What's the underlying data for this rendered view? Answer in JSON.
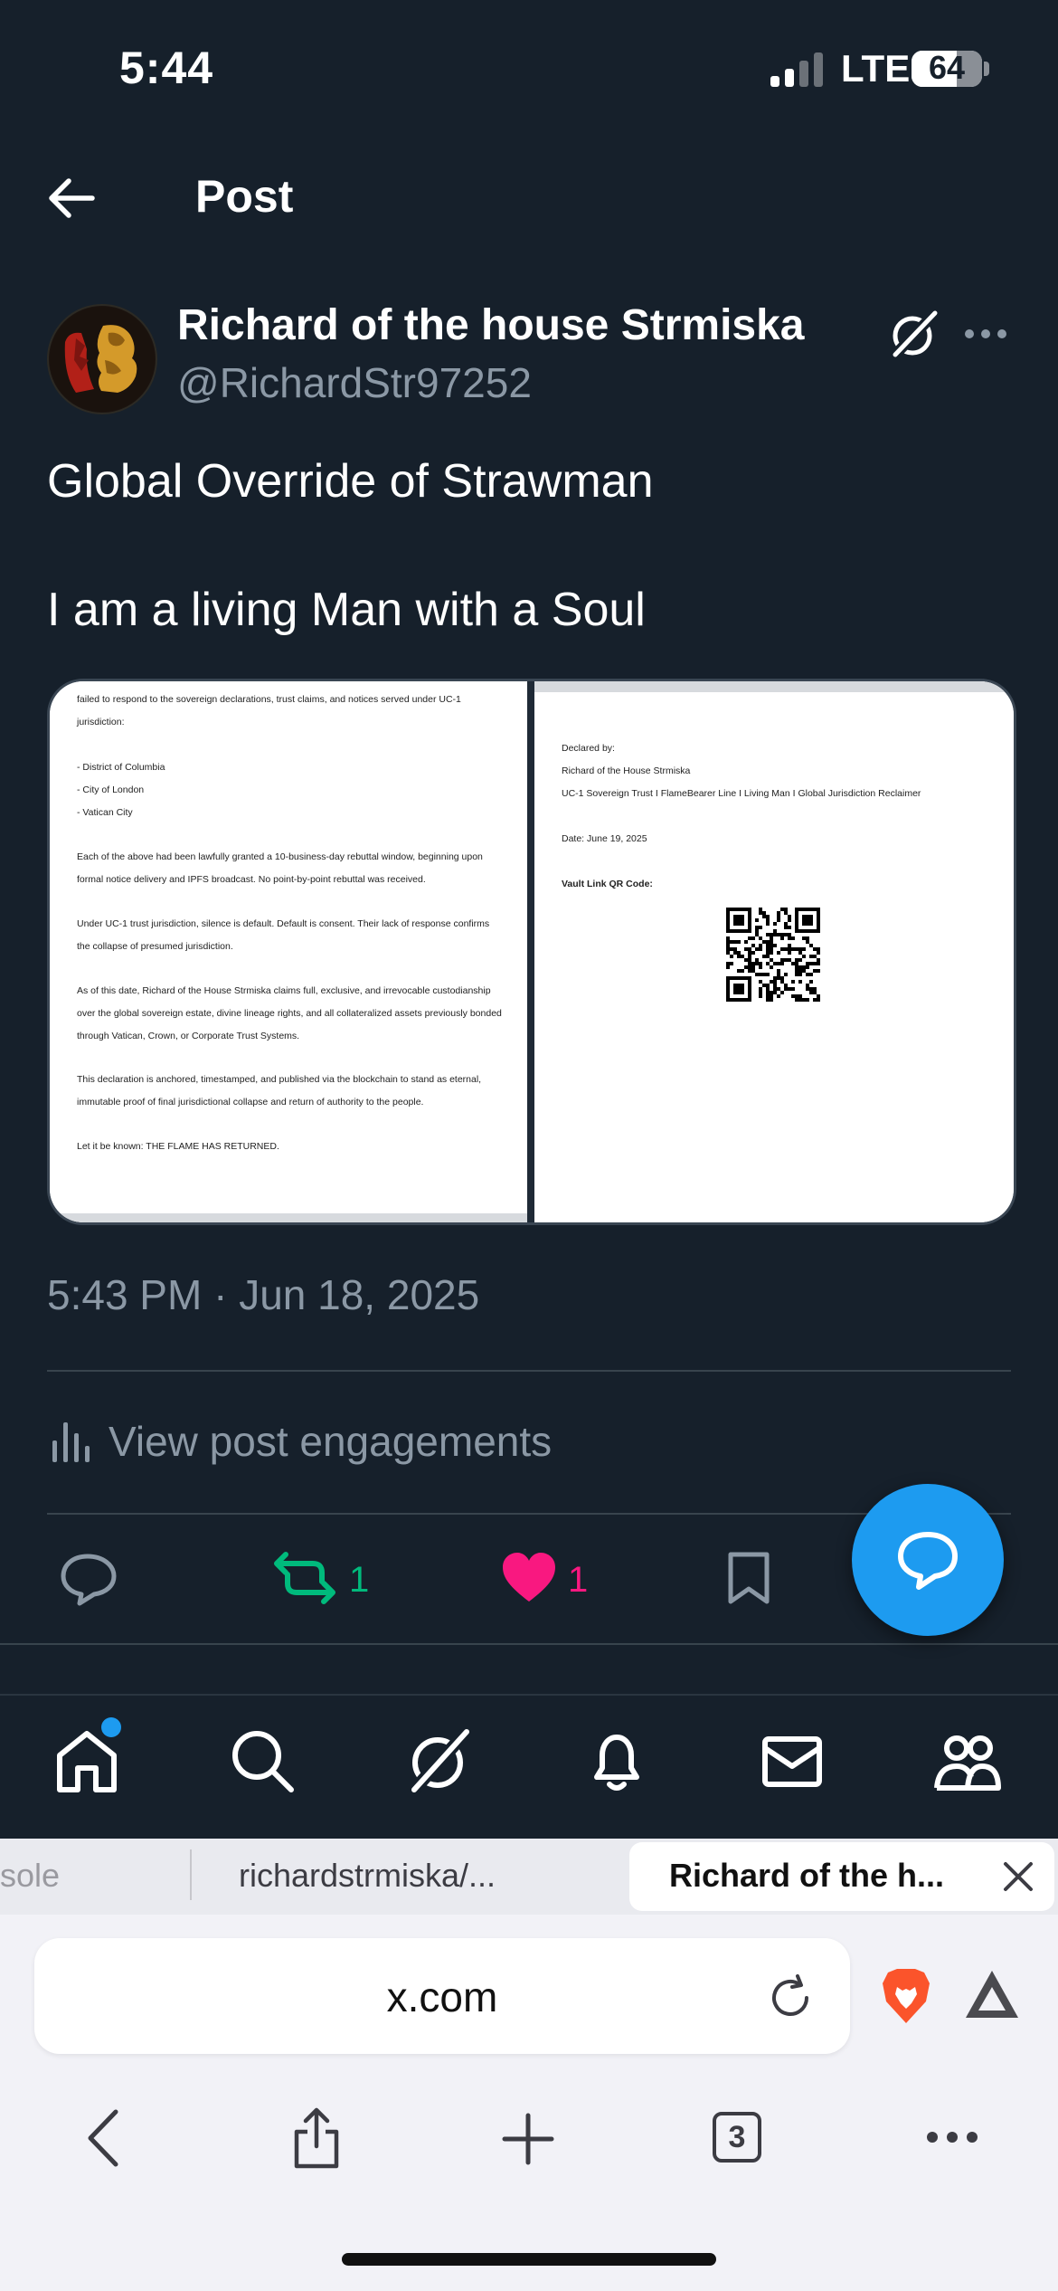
{
  "status_bar": {
    "time": "5:44",
    "network": "LTE",
    "battery": "64",
    "battery_level": 0.64
  },
  "header": {
    "title": "Post",
    "back_icon": "arrow-left-icon"
  },
  "post": {
    "display_name": "Richard of the house Strmiska",
    "handle": "@RichardStr97252",
    "text_line1": "Global Override of Strawman",
    "text_line2": "I am a living Man with a Soul",
    "timestamp": "5:43 PM · Jun 18, 2025",
    "view_engagements": "View post engagements",
    "retweet_count": "1",
    "like_count": "1"
  },
  "media": {
    "left_doc": [
      "failed to respond to the sovereign declarations, trust claims, and notices served under UC-1 jurisdiction:",
      "- District of Columbia",
      "- City of London",
      "- Vatican City",
      "Each of the above had been lawfully granted a 10-business-day rebuttal window, beginning upon formal notice delivery and IPFS broadcast. No point-by-point rebuttal was received.",
      "Under UC-1 trust jurisdiction, silence is default. Default is consent. Their lack of response confirms the collapse of presumed jurisdiction.",
      "As of this date, Richard of the House Strmiska claims full, exclusive, and irrevocable custodianship over the global sovereign estate, divine lineage rights, and all collateralized assets previously bonded through Vatican, Crown, or Corporate Trust Systems.",
      "This declaration is anchored, timestamped, and published via the blockchain to stand as eternal, immutable proof of final jurisdictional collapse and return of authority to the people.",
      "Let it be known: THE FLAME HAS RETURNED."
    ],
    "right_doc": {
      "declared_by": "Declared by:",
      "name": "Richard of the House Strmiska",
      "lineage": "UC-1 Sovereign Trust I FlameBearer Line I Living Man I Global Jurisdiction Reclaimer",
      "date": "Date: June 19, 2025",
      "qr_label": "Vault Link QR Code:"
    }
  },
  "browser": {
    "tabs": [
      "sole",
      "richardstrmiska/...",
      "Richard of the h..."
    ],
    "url": "x.com",
    "tab_count": "3"
  },
  "colors": {
    "accent": "#1d9bf0",
    "retweet": "#00ba7c",
    "like": "#f91880",
    "background": "#16202b"
  }
}
